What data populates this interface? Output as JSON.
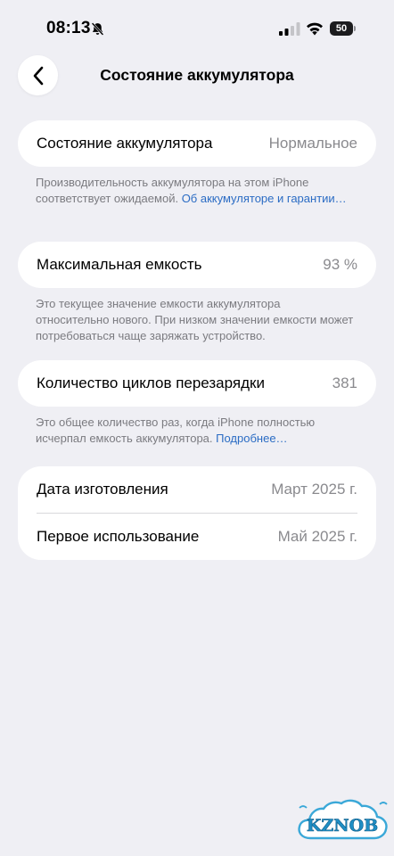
{
  "status_bar": {
    "time": "08:13",
    "battery_level": "50",
    "icons": [
      "bell-slash-icon",
      "signal-icon",
      "wifi-icon",
      "battery-icon"
    ]
  },
  "nav": {
    "back_icon": "chevron-left-icon",
    "title": "Состояние аккумулятора"
  },
  "battery_health": {
    "label": "Состояние аккумулятора",
    "value": "Нормальное",
    "footnote_text": "Производительность аккумулятора на этом iPhone соответствует ожидаемой. ",
    "footnote_link": "Об аккумуляторе и гаранти­и…"
  },
  "max_capacity": {
    "label": "Максимальная емкость",
    "value": "93 %",
    "footnote_text": "Это текущее значение емкости аккумулятора относительно нового. При низком значении емкости может потребоваться чаще заряжать устройство."
  },
  "cycle_count": {
    "label": "Количество циклов перезарядки",
    "value": "381",
    "footnote_text": "Это общее количество раз, когда iPhone полностью исчерпал емкость аккумулятора. ",
    "footnote_link": "Подробнее…"
  },
  "dates": {
    "manufacture_label": "Дата изготовления",
    "manufacture_value": "Март 2025 г.",
    "first_use_label": "Первое использование",
    "first_use_value": "Май 2025 г."
  },
  "watermark": {
    "text": "KZNOB"
  },
  "colors": {
    "background": "#efeff4",
    "card": "#ffffff",
    "link": "#2b6cc4",
    "secondary_text": "#8a8a8e"
  }
}
